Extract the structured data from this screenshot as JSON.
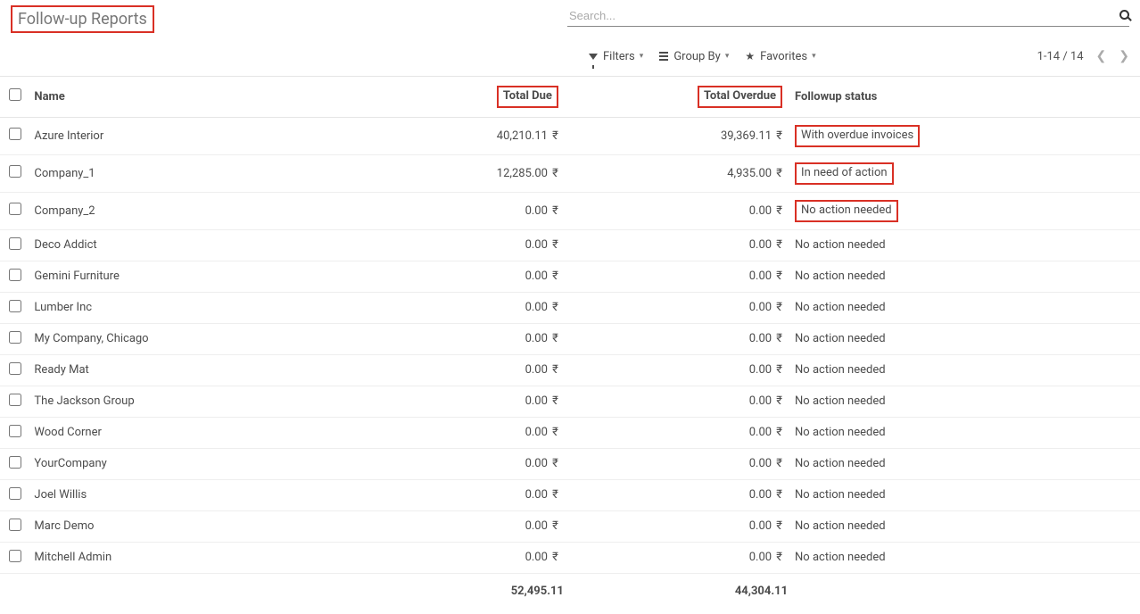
{
  "header": {
    "title": "Follow-up Reports",
    "search_placeholder": "Search..."
  },
  "controls": {
    "filters_label": "Filters",
    "groupby_label": "Group By",
    "favorites_label": "Favorites",
    "pager_text": "1-14 / 14"
  },
  "table": {
    "columns": {
      "name": "Name",
      "total_due": "Total Due",
      "total_overdue": "Total Overdue",
      "status": "Followup status"
    },
    "currency_symbol": "₹",
    "rows": [
      {
        "name": "Azure Interior",
        "total_due": "40,210.11",
        "total_overdue": "39,369.11",
        "status": "With overdue invoices",
        "highlight_status": true
      },
      {
        "name": "Company_1",
        "total_due": "12,285.00",
        "total_overdue": "4,935.00",
        "status": "In need of action",
        "highlight_status": true
      },
      {
        "name": "Company_2",
        "total_due": "0.00",
        "total_overdue": "0.00",
        "status": "No action needed",
        "highlight_status": true
      },
      {
        "name": "Deco Addict",
        "total_due": "0.00",
        "total_overdue": "0.00",
        "status": "No action needed",
        "highlight_status": false
      },
      {
        "name": "Gemini Furniture",
        "total_due": "0.00",
        "total_overdue": "0.00",
        "status": "No action needed",
        "highlight_status": false
      },
      {
        "name": "Lumber Inc",
        "total_due": "0.00",
        "total_overdue": "0.00",
        "status": "No action needed",
        "highlight_status": false
      },
      {
        "name": "My Company, Chicago",
        "total_due": "0.00",
        "total_overdue": "0.00",
        "status": "No action needed",
        "highlight_status": false
      },
      {
        "name": "Ready Mat",
        "total_due": "0.00",
        "total_overdue": "0.00",
        "status": "No action needed",
        "highlight_status": false
      },
      {
        "name": "The Jackson Group",
        "total_due": "0.00",
        "total_overdue": "0.00",
        "status": "No action needed",
        "highlight_status": false
      },
      {
        "name": "Wood Corner",
        "total_due": "0.00",
        "total_overdue": "0.00",
        "status": "No action needed",
        "highlight_status": false
      },
      {
        "name": "YourCompany",
        "total_due": "0.00",
        "total_overdue": "0.00",
        "status": "No action needed",
        "highlight_status": false
      },
      {
        "name": "Joel Willis",
        "total_due": "0.00",
        "total_overdue": "0.00",
        "status": "No action needed",
        "highlight_status": false
      },
      {
        "name": "Marc Demo",
        "total_due": "0.00",
        "total_overdue": "0.00",
        "status": "No action needed",
        "highlight_status": false
      },
      {
        "name": "Mitchell Admin",
        "total_due": "0.00",
        "total_overdue": "0.00",
        "status": "No action needed",
        "highlight_status": false
      }
    ],
    "footer": {
      "total_due": "52,495.11",
      "total_overdue": "44,304.11"
    }
  }
}
